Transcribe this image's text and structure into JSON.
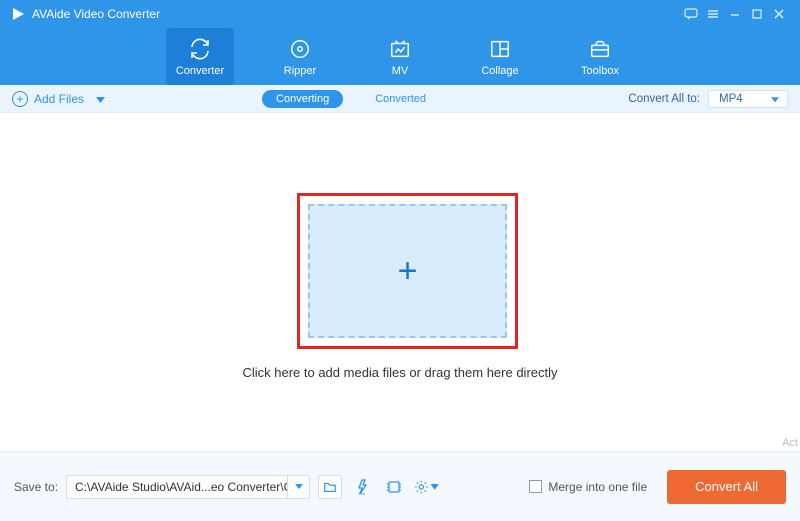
{
  "window": {
    "title": "AVAide Video Converter"
  },
  "nav": {
    "tabs": [
      {
        "label": "Converter",
        "active": true
      },
      {
        "label": "Ripper"
      },
      {
        "label": "MV"
      },
      {
        "label": "Collage"
      },
      {
        "label": "Toolbox"
      }
    ]
  },
  "toolbar": {
    "add_files_label": "Add Files",
    "segments": {
      "converting": "Converting",
      "converted": "Converted",
      "active": "converting"
    },
    "convert_all_to_label": "Convert All to:",
    "format_selected": "MP4"
  },
  "dropzone": {
    "caption": "Click here to add media files or drag them here directly"
  },
  "bottom": {
    "save_to_label": "Save to:",
    "save_path": "C:\\AVAide Studio\\AVAid...eo Converter\\Converted",
    "merge_label": "Merge into one file",
    "convert_all_button": "Convert All"
  },
  "misc": {
    "act": "Act"
  }
}
